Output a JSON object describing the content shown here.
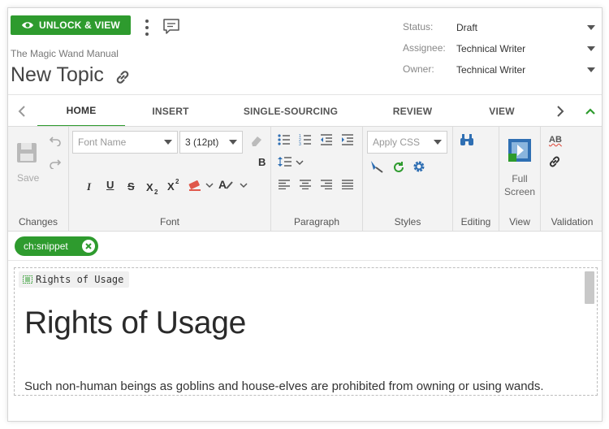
{
  "header": {
    "unlock_label": "UNLOCK & VIEW",
    "manual_title": "The Magic Wand Manual",
    "topic_title": "New Topic"
  },
  "meta": {
    "status": {
      "label": "Status:",
      "value": "Draft"
    },
    "assignee": {
      "label": "Assignee:",
      "value": "Technical Writer"
    },
    "owner": {
      "label": "Owner:",
      "value": "Technical Writer"
    }
  },
  "tabs": [
    {
      "label": "HOME",
      "active": true
    },
    {
      "label": "INSERT",
      "active": false
    },
    {
      "label": "SINGLE-SOURCING",
      "active": false
    },
    {
      "label": "REVIEW",
      "active": false
    },
    {
      "label": "VIEW",
      "active": false
    }
  ],
  "ribbon": {
    "changes": {
      "label": "Changes",
      "save_label": "Save"
    },
    "font": {
      "label": "Font",
      "font_name_placeholder": "Font Name",
      "font_size_value": "3 (12pt)",
      "bold_label": "B",
      "italic_label": "I",
      "underline_label": "U",
      "strike_label": "S"
    },
    "paragraph": {
      "label": "Paragraph"
    },
    "styles": {
      "label": "Styles",
      "apply_css_placeholder": "Apply CSS"
    },
    "editing": {
      "label": "Editing"
    },
    "view": {
      "label": "View",
      "full_screen_label": "Full Screen"
    },
    "validation": {
      "label": "Validation",
      "spell_label": "AB"
    }
  },
  "tag": {
    "chip_label": "ch:snippet"
  },
  "editor": {
    "snippet_label": "Rights of Usage",
    "heading": "Rights of Usage",
    "paragraph": "Such non-human beings as goblins and house-elves are prohibited from owning or using wands."
  },
  "colors": {
    "accent": "#2e9b2e",
    "link_blue": "#2f6fb3"
  }
}
